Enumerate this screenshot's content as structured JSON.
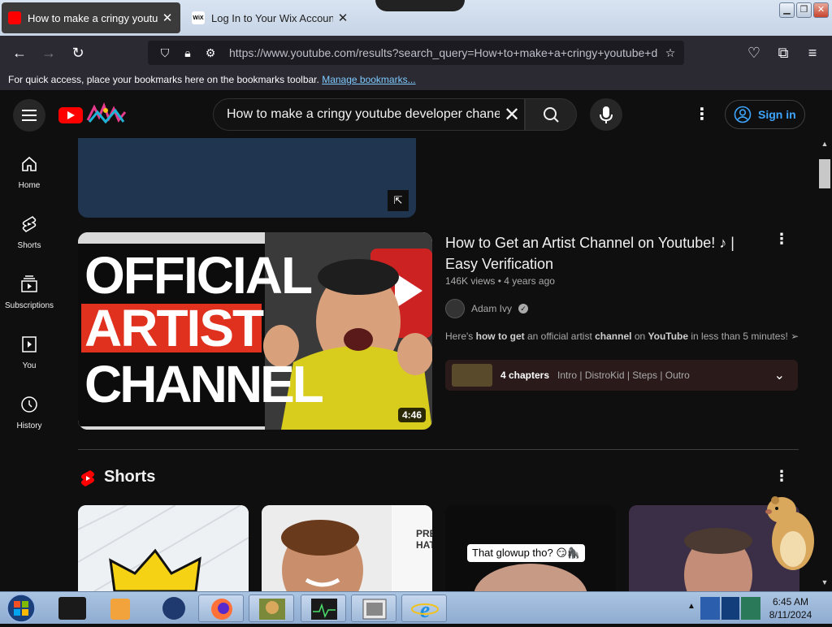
{
  "browser": {
    "tabs": [
      {
        "title": "How to make a cringy youtube",
        "favicon": "youtube-favicon",
        "active": true
      },
      {
        "title": "Log In to Your Wix Account - W",
        "favicon_text": "WiX",
        "active": false
      }
    ],
    "close_glyph": "✕",
    "url": "https://www.youtube.com/results?search_query=How+to+make+a+cringy+youtube+d",
    "bookmarks_text": "For quick access, place your bookmarks here on the bookmarks toolbar.",
    "bookmarks_link": "Manage bookmarks..."
  },
  "youtube": {
    "search_value": "How to make a cringy youtube developer chanel",
    "signin_label": "Sign in",
    "nav": [
      {
        "label": "Home",
        "icon": "home-icon"
      },
      {
        "label": "Shorts",
        "icon": "shorts-icon"
      },
      {
        "label": "Subscriptions",
        "icon": "subscriptions-icon"
      },
      {
        "label": "You",
        "icon": "you-icon"
      },
      {
        "label": "History",
        "icon": "history-icon"
      }
    ],
    "video": {
      "title": "How to Get an Artist Channel on Youtube! ♪ | Easy Verification",
      "meta": "146K views • 4 years ago",
      "channel": "Adam Ivy",
      "description_parts": [
        "Here's ",
        "how to get",
        " an official artist ",
        "channel",
        " on ",
        "YouTube",
        " in less than 5 minutes! ➢..."
      ],
      "duration": "4:46",
      "thumb_lines": [
        "OFFICIAL",
        "ARTIST",
        "CHANNEL"
      ],
      "chapters_count": "4 chapters",
      "chapters_list": "Intro | DistroKid | Steps | Outro"
    },
    "shorts_heading": "Shorts",
    "short3_caption": "That glowup tho? 😏🦍",
    "short2_sign": "PRE HAT"
  },
  "taskbar": {
    "time": "6:45 AM",
    "date": "8/11/2024"
  },
  "colors": {
    "yt_red": "#ff0000",
    "link_blue": "#3ea6ff",
    "bg": "#0f0f0f"
  }
}
